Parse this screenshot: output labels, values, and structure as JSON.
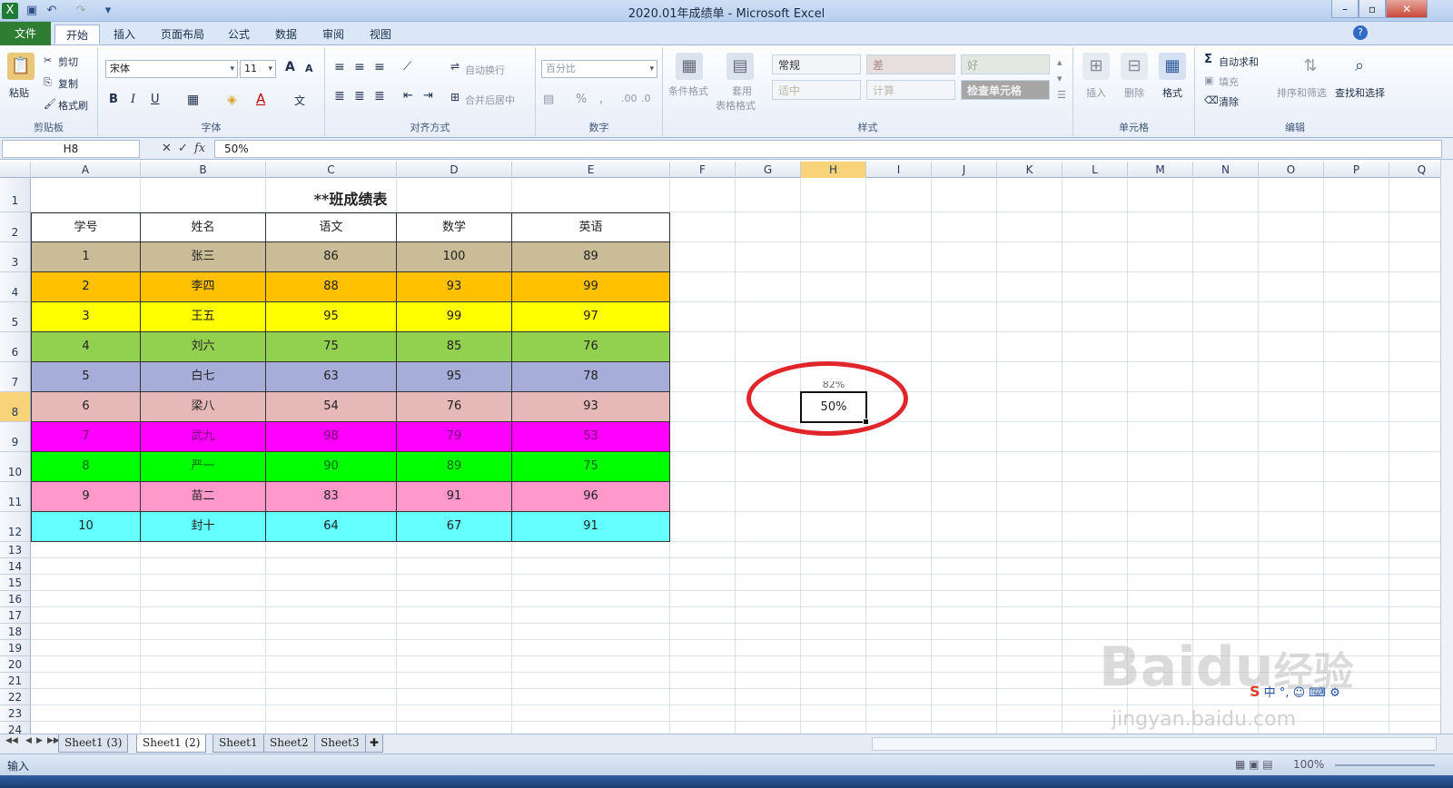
{
  "window": {
    "title": "2020.01年成绩单 - Microsoft Excel",
    "controls": [
      "–",
      "▫",
      "✕"
    ]
  },
  "tabs": [
    "文件",
    "开始",
    "插入",
    "页面布局",
    "公式",
    "数据",
    "审阅",
    "视图"
  ],
  "ribbon": {
    "clipboard": {
      "paste": "粘贴",
      "cut": "剪切",
      "copy": "复制",
      "format_painter": "格式刷",
      "label": "剪贴板"
    },
    "font": {
      "name": "宋体",
      "size": "11",
      "grow": "A",
      "shrink": "A",
      "bold": "B",
      "italic": "I",
      "underline": "U",
      "label": "字体"
    },
    "alignment": {
      "wrap": "自动换行",
      "merge": "合并后居中",
      "label": "对齐方式"
    },
    "number": {
      "format": "百分比",
      "percent": "%",
      "comma": ",",
      "label": "数字"
    },
    "styles": {
      "cond_format": "条件格式",
      "table_format_1": "套用",
      "table_format_2": "表格格式",
      "normal": "常规",
      "bad": "差",
      "good": "好",
      "neutral": "适中",
      "calc": "计算",
      "check": "检查单元格",
      "label": "样式"
    },
    "cells": {
      "insert": "插入",
      "delete": "删除",
      "format": "格式",
      "label": "单元格"
    },
    "editing": {
      "autosum": "自动求和",
      "fill": "填充",
      "clear": "清除",
      "sort": "排序和筛选",
      "find": "查找和选择",
      "label": "编辑"
    }
  },
  "formula_bar": {
    "name_box": "H8",
    "fx": "fx",
    "content": "50%"
  },
  "columns": [
    "A",
    "B",
    "C",
    "D",
    "E",
    "F",
    "G",
    "H",
    "I",
    "J",
    "K",
    "L",
    "M",
    "N",
    "O",
    "P",
    "Q"
  ],
  "rows": [
    "1",
    "2",
    "3",
    "4",
    "5",
    "6",
    "7",
    "8",
    "9",
    "10",
    "11",
    "12",
    "13",
    "14",
    "15",
    "16",
    "17",
    "18",
    "19",
    "20",
    "21",
    "22",
    "23",
    "24"
  ],
  "sheet": {
    "title": "**班成绩表",
    "headers": [
      "学号",
      "姓名",
      "语文",
      "数学",
      "英语"
    ],
    "records": [
      {
        "cells": [
          "1",
          "张三",
          "86",
          "100",
          "89"
        ],
        "fill": "#c9bc97",
        "text": "#222222"
      },
      {
        "cells": [
          "2",
          "李四",
          "88",
          "93",
          "99"
        ],
        "fill": "#ffc000",
        "text": "#222222"
      },
      {
        "cells": [
          "3",
          "王五",
          "95",
          "99",
          "97"
        ],
        "fill": "#ffff00",
        "text": "#222222"
      },
      {
        "cells": [
          "4",
          "刘六",
          "75",
          "85",
          "76"
        ],
        "fill": "#92d050",
        "text": "#222222"
      },
      {
        "cells": [
          "5",
          "白七",
          "63",
          "95",
          "78"
        ],
        "fill": "#a6add9",
        "text": "#222222"
      },
      {
        "cells": [
          "6",
          "梁八",
          "54",
          "76",
          "93"
        ],
        "fill": "#e6b8b7",
        "text": "#222222"
      },
      {
        "cells": [
          "7",
          "武九",
          "98",
          "79",
          "53"
        ],
        "fill": "#ff00ff",
        "text": "#7a0a7a"
      },
      {
        "cells": [
          "8",
          "严一",
          "90",
          "89",
          "75"
        ],
        "fill": "#00ff00",
        "text": "#0b6b0b"
      },
      {
        "cells": [
          "9",
          "苗二",
          "83",
          "91",
          "96"
        ],
        "fill": "#ff99cc",
        "text": "#222222"
      },
      {
        "cells": [
          "10",
          "封十",
          "64",
          "67",
          "91"
        ],
        "fill": "#66ffff",
        "text": "#222222"
      }
    ],
    "active_cell": {
      "ref": "H8",
      "value": "50%"
    },
    "above_value": "82%"
  },
  "sheet_tabs": [
    "Sheet1 (3)",
    "Sheet1 (2)",
    "Sheet1",
    "Sheet2",
    "Sheet3"
  ],
  "active_sheet_tab": "Sheet1 (2)",
  "status": {
    "mode": "输入",
    "zoom": "100%"
  },
  "watermark": {
    "brand": "Bai",
    "brand2": "du",
    "brand3": "经验",
    "url": "jingyan.baidu.com"
  },
  "ime": {
    "text": "中 °, ☺ ⌨ ⚙"
  },
  "colors": {
    "accent_file_tab": "#2f7d32",
    "annotation_circle": "#e0262b",
    "selected_header": "#f8d37a"
  }
}
